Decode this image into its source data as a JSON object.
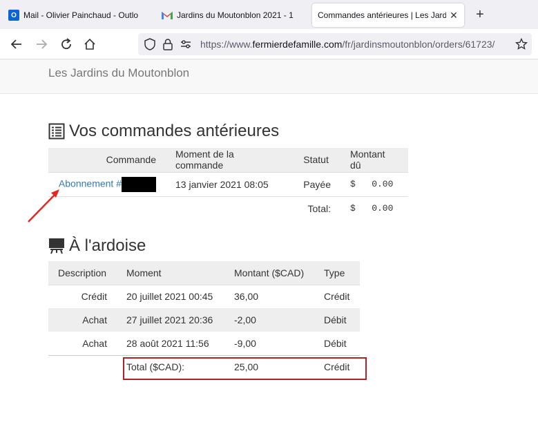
{
  "browser": {
    "tabs": [
      {
        "title": "Mail - Olivier Painchaud - Outlo",
        "icon": "outlook-icon"
      },
      {
        "title": "Jardins du Moutonblon 2021 - 1",
        "icon": "gmail-icon"
      },
      {
        "title": "Commandes antérieures | Les Jardin",
        "icon": "none",
        "active": true
      }
    ],
    "url_prefix": "https://www.",
    "url_host": "fermierdefamille.com",
    "url_path": "/fr/jardinsmoutonblon/orders/61723/"
  },
  "site": {
    "brand": "Les Jardins du Moutonblon"
  },
  "orders": {
    "heading": "Vos commandes antérieures",
    "headers": [
      "Commande",
      "Moment de la commande",
      "Statut",
      "Montant dû"
    ],
    "row": {
      "order_link": "Abonnement #",
      "moment": "13 janvier 2021 08:05",
      "status": "Payée",
      "currency": "$",
      "amount": "0.00"
    },
    "total_label": "Total:",
    "total_currency": "$",
    "total_amount": "0.00"
  },
  "ardoise": {
    "heading": "À l'ardoise",
    "headers": [
      "Description",
      "Moment",
      "Montant ($CAD)",
      "Type"
    ],
    "rows": [
      {
        "description": "Crédit",
        "moment": "20 juillet 2021 00:45",
        "amount": "36,00",
        "type": "Crédit"
      },
      {
        "description": "Achat",
        "moment": "27 juillet 2021 20:36",
        "amount": "-2,00",
        "type": "Débit"
      },
      {
        "description": "Achat",
        "moment": "28 août 2021 11:56",
        "amount": "-9,00",
        "type": "Débit"
      }
    ],
    "total_label": "Total ($CAD):",
    "total_amount": "25,00",
    "total_type": "Crédit"
  },
  "colors": {
    "link": "#337ab7",
    "highlight_box": "#b2202a",
    "annotation_arrow": "#e8261f"
  }
}
